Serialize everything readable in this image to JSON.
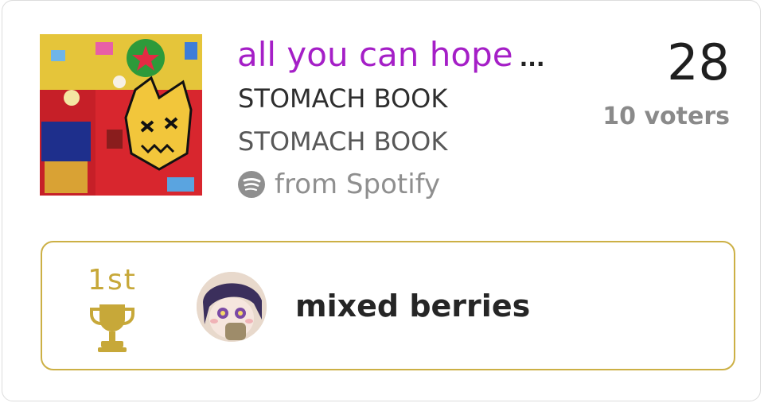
{
  "track": {
    "title": "all you can hope",
    "title_truncation": "...",
    "artist": "STOMACH BOOK",
    "album": "STOMACH BOOK",
    "source_label": "from Spotify",
    "source_icon": "spotify-icon",
    "cover_icon": "album-cover-image"
  },
  "stats": {
    "score": "28",
    "voters": "10 voters"
  },
  "ranking": {
    "place": "1st",
    "trophy_icon": "trophy-icon",
    "user_name": "mixed berries",
    "avatar_icon": "user-avatar"
  },
  "colors": {
    "title": "#a51fc7",
    "gold": "#ccb045",
    "muted": "#8f8f8f"
  }
}
